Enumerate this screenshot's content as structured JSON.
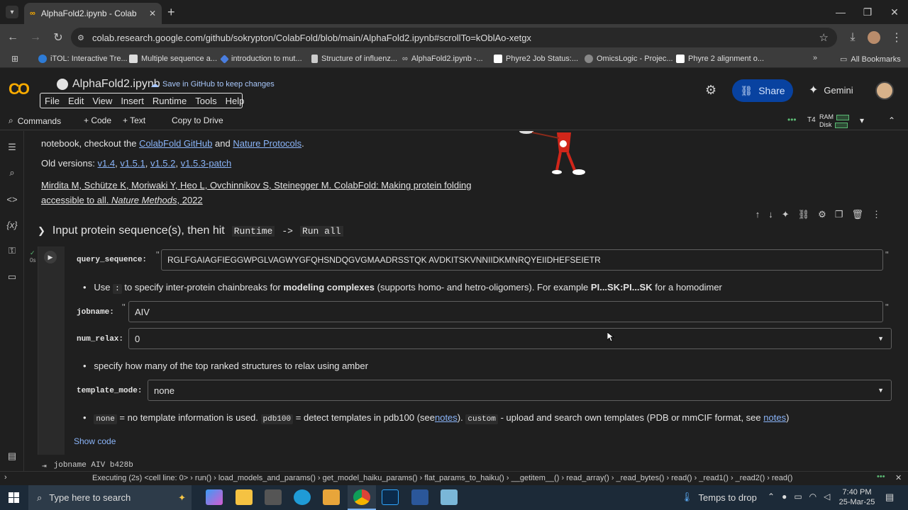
{
  "browser": {
    "tab_title": "AlphaFold2.ipynb - Colab",
    "url": "colab.research.google.com/github/sokrypton/ColabFold/blob/main/AlphaFold2.ipynb#scrollTo=kOblAo-xetgx",
    "bookmarks": [
      "iTOL: Interactive Tre...",
      "Multiple sequence a...",
      "introduction to mut...",
      "Structure of influenz...",
      "AlphaFold2.ipynb -...",
      "Phyre2 Job Status:...",
      "OmicsLogic - Projec...",
      "Phyre 2 alignment o..."
    ],
    "all_bookmarks": "All Bookmarks"
  },
  "colab": {
    "notebook_title": "AlphaFold2.ipynb",
    "save_github": "Save in GitHub to keep changes",
    "menu": [
      "File",
      "Edit",
      "View",
      "Insert",
      "Runtime",
      "Tools",
      "Help"
    ],
    "share": "Share",
    "gemini": "Gemini",
    "toolbar": {
      "commands": "Commands",
      "code": "+ Code",
      "text": "+ Text",
      "copy_drive": "Copy to Drive",
      "runtime": "T4",
      "ram": "RAM",
      "disk": "Disk"
    }
  },
  "content": {
    "line0_a": "notebook, checkout the",
    "line0_link1": "ColabFold GitHub",
    "line0_and": "and",
    "line0_link2": "Nature Protocols",
    "line0_end": ".",
    "old_versions_label": "Old versions:",
    "versions": [
      "v1.4",
      "v1.5.1",
      "v1.5.2",
      "v1.5.3-patch"
    ],
    "citation_line1": "Mirdita M, Schütze K, Moriwaki Y, Heo L, Ovchinnikov S, Steinegger M. ColabFold: Making protein folding",
    "citation_line2a": "accessible to all.",
    "citation_journal": "Nature Methods",
    "citation_year": ", 2022",
    "section_title_a": "Input protein sequence(s), then hit",
    "section_code_runtime": "Runtime",
    "section_arrow": "->",
    "section_code_runall": "Run all",
    "cell_run_time": "0s",
    "query_sequence_label": "query_sequence:",
    "query_sequence_value": "RGLFGAIAGFIEGGWPGLVAGWYGFQHSNDQGVGMAADRSSTQK AVDKITSKVNNIIDKMNRQYEIIDHEFSEIETR",
    "bullet1_a": "Use",
    "bullet1_code": ":",
    "bullet1_b": "to specify inter-protein chainbreaks for",
    "bullet1_bold": "modeling complexes",
    "bullet1_c": "(supports homo- and hetro-oligomers). For example",
    "bullet1_bold2": "PI...SK:PI...SK",
    "bullet1_d": "for a homodimer",
    "jobname_label": "jobname:",
    "jobname_value": "AIV",
    "num_relax_label": "num_relax:",
    "num_relax_value": "0",
    "bullet2": "specify how many of the top ranked structures to relax using amber",
    "template_mode_label": "template_mode:",
    "template_mode_value": "none",
    "bullet3_code1": "none",
    "bullet3_a": "= no template information is used.",
    "bullet3_code2": "pdb100",
    "bullet3_b": "= detect templates in pdb100 (see",
    "bullet3_link1": "notes",
    "bullet3_c": ").",
    "bullet3_code3": "custom",
    "bullet3_d": "- upload and search own templates (PDB or mmCIF format, see",
    "bullet3_link2": "notes",
    "bullet3_e": ")",
    "show_code": "Show code",
    "output_line": "jobname AIV b428b"
  },
  "status": {
    "text": "Executing (2s)  <cell line: 0> › run() › load_models_and_params() › get_model_haiku_params() › flat_params_to_haiku() › __getitem__() › read_array() › _read_bytes() › read() › _read1() › _read2() › read()"
  },
  "taskbar": {
    "search_placeholder": "Type here to search",
    "weather": "Temps to drop",
    "time": "7:40 PM",
    "date": "25-Mar-25"
  },
  "colors": {
    "accent_blue": "#0842a0",
    "link": "#8ab4f8",
    "colab_orange": "#f9ab00"
  }
}
